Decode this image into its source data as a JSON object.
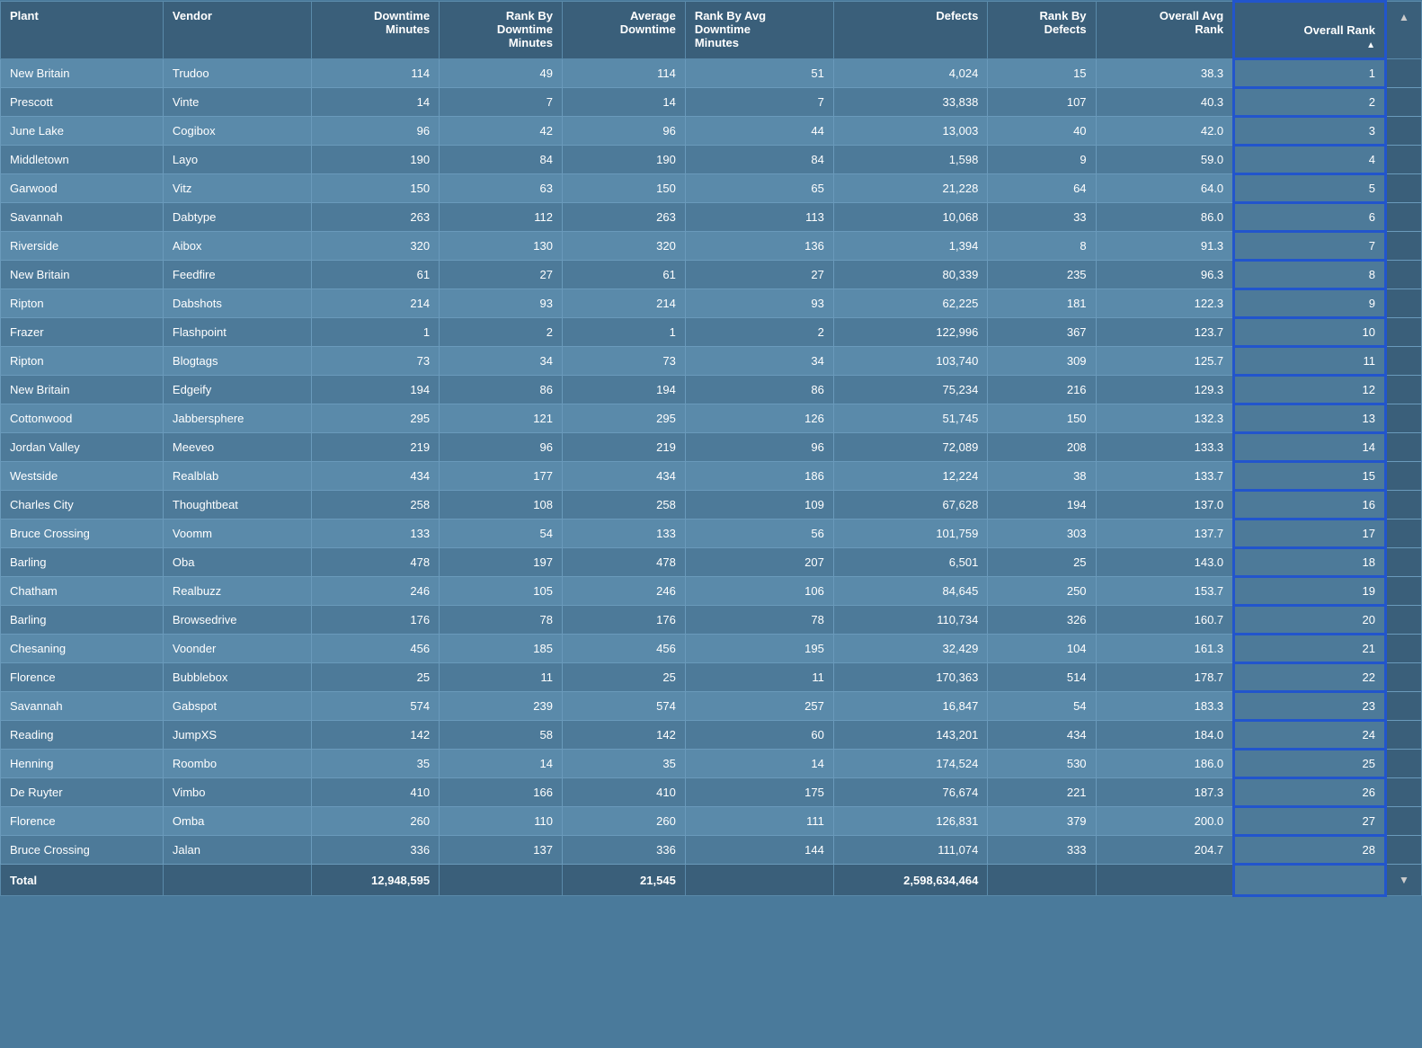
{
  "headers": {
    "plant": "Plant",
    "vendor": "Vendor",
    "downtime_minutes": "Downtime\nMinutes",
    "rank_by_downtime": "Rank By\nDowntime\nMinutes",
    "avg_downtime": "Average\nDowntime",
    "rank_by_avg": "Rank By Avg\nDowntime\nMinutes",
    "defects": "Defects",
    "rank_by_defects": "Rank By\nDefects",
    "overall_avg_rank": "Overall Avg\nRank",
    "overall_rank": "Overall Rank"
  },
  "rows": [
    {
      "plant": "New Britain",
      "vendor": "Trudoo",
      "downtime": 114,
      "rank_down": 49,
      "avg_down": 114,
      "rank_avg": 51,
      "defects": "4,024",
      "rank_def": 15,
      "overall_avg": "38.3",
      "overall_rank": 1
    },
    {
      "plant": "Prescott",
      "vendor": "Vinte",
      "downtime": 14,
      "rank_down": 7,
      "avg_down": 14,
      "rank_avg": 7,
      "defects": "33,838",
      "rank_def": 107,
      "overall_avg": "40.3",
      "overall_rank": 2
    },
    {
      "plant": "June Lake",
      "vendor": "Cogibox",
      "downtime": 96,
      "rank_down": 42,
      "avg_down": 96,
      "rank_avg": 44,
      "defects": "13,003",
      "rank_def": 40,
      "overall_avg": "42.0",
      "overall_rank": 3
    },
    {
      "plant": "Middletown",
      "vendor": "Layo",
      "downtime": 190,
      "rank_down": 84,
      "avg_down": 190,
      "rank_avg": 84,
      "defects": "1,598",
      "rank_def": 9,
      "overall_avg": "59.0",
      "overall_rank": 4
    },
    {
      "plant": "Garwood",
      "vendor": "Vitz",
      "downtime": 150,
      "rank_down": 63,
      "avg_down": 150,
      "rank_avg": 65,
      "defects": "21,228",
      "rank_def": 64,
      "overall_avg": "64.0",
      "overall_rank": 5
    },
    {
      "plant": "Savannah",
      "vendor": "Dabtype",
      "downtime": 263,
      "rank_down": 112,
      "avg_down": 263,
      "rank_avg": 113,
      "defects": "10,068",
      "rank_def": 33,
      "overall_avg": "86.0",
      "overall_rank": 6
    },
    {
      "plant": "Riverside",
      "vendor": "Aibox",
      "downtime": 320,
      "rank_down": 130,
      "avg_down": 320,
      "rank_avg": 136,
      "defects": "1,394",
      "rank_def": 8,
      "overall_avg": "91.3",
      "overall_rank": 7
    },
    {
      "plant": "New Britain",
      "vendor": "Feedfire",
      "downtime": 61,
      "rank_down": 27,
      "avg_down": 61,
      "rank_avg": 27,
      "defects": "80,339",
      "rank_def": 235,
      "overall_avg": "96.3",
      "overall_rank": 8
    },
    {
      "plant": "Ripton",
      "vendor": "Dabshots",
      "downtime": 214,
      "rank_down": 93,
      "avg_down": 214,
      "rank_avg": 93,
      "defects": "62,225",
      "rank_def": 181,
      "overall_avg": "122.3",
      "overall_rank": 9
    },
    {
      "plant": "Frazer",
      "vendor": "Flashpoint",
      "downtime": 1,
      "rank_down": 2,
      "avg_down": 1,
      "rank_avg": 2,
      "defects": "122,996",
      "rank_def": 367,
      "overall_avg": "123.7",
      "overall_rank": 10
    },
    {
      "plant": "Ripton",
      "vendor": "Blogtags",
      "downtime": 73,
      "rank_down": 34,
      "avg_down": 73,
      "rank_avg": 34,
      "defects": "103,740",
      "rank_def": 309,
      "overall_avg": "125.7",
      "overall_rank": 11
    },
    {
      "plant": "New Britain",
      "vendor": "Edgeify",
      "downtime": 194,
      "rank_down": 86,
      "avg_down": 194,
      "rank_avg": 86,
      "defects": "75,234",
      "rank_def": 216,
      "overall_avg": "129.3",
      "overall_rank": 12
    },
    {
      "plant": "Cottonwood",
      "vendor": "Jabbersphere",
      "downtime": 295,
      "rank_down": 121,
      "avg_down": 295,
      "rank_avg": 126,
      "defects": "51,745",
      "rank_def": 150,
      "overall_avg": "132.3",
      "overall_rank": 13
    },
    {
      "plant": "Jordan Valley",
      "vendor": "Meeveo",
      "downtime": 219,
      "rank_down": 96,
      "avg_down": 219,
      "rank_avg": 96,
      "defects": "72,089",
      "rank_def": 208,
      "overall_avg": "133.3",
      "overall_rank": 14
    },
    {
      "plant": "Westside",
      "vendor": "Realblab",
      "downtime": 434,
      "rank_down": 177,
      "avg_down": 434,
      "rank_avg": 186,
      "defects": "12,224",
      "rank_def": 38,
      "overall_avg": "133.7",
      "overall_rank": 15
    },
    {
      "plant": "Charles City",
      "vendor": "Thoughtbeat",
      "downtime": 258,
      "rank_down": 108,
      "avg_down": 258,
      "rank_avg": 109,
      "defects": "67,628",
      "rank_def": 194,
      "overall_avg": "137.0",
      "overall_rank": 16
    },
    {
      "plant": "Bruce Crossing",
      "vendor": "Voomm",
      "downtime": 133,
      "rank_down": 54,
      "avg_down": 133,
      "rank_avg": 56,
      "defects": "101,759",
      "rank_def": 303,
      "overall_avg": "137.7",
      "overall_rank": 17
    },
    {
      "plant": "Barling",
      "vendor": "Oba",
      "downtime": 478,
      "rank_down": 197,
      "avg_down": 478,
      "rank_avg": 207,
      "defects": "6,501",
      "rank_def": 25,
      "overall_avg": "143.0",
      "overall_rank": 18
    },
    {
      "plant": "Chatham",
      "vendor": "Realbuzz",
      "downtime": 246,
      "rank_down": 105,
      "avg_down": 246,
      "rank_avg": 106,
      "defects": "84,645",
      "rank_def": 250,
      "overall_avg": "153.7",
      "overall_rank": 19
    },
    {
      "plant": "Barling",
      "vendor": "Browsedrive",
      "downtime": 176,
      "rank_down": 78,
      "avg_down": 176,
      "rank_avg": 78,
      "defects": "110,734",
      "rank_def": 326,
      "overall_avg": "160.7",
      "overall_rank": 20
    },
    {
      "plant": "Chesaning",
      "vendor": "Voonder",
      "downtime": 456,
      "rank_down": 185,
      "avg_down": 456,
      "rank_avg": 195,
      "defects": "32,429",
      "rank_def": 104,
      "overall_avg": "161.3",
      "overall_rank": 21
    },
    {
      "plant": "Florence",
      "vendor": "Bubblebox",
      "downtime": 25,
      "rank_down": 11,
      "avg_down": 25,
      "rank_avg": 11,
      "defects": "170,363",
      "rank_def": 514,
      "overall_avg": "178.7",
      "overall_rank": 22
    },
    {
      "plant": "Savannah",
      "vendor": "Gabspot",
      "downtime": 574,
      "rank_down": 239,
      "avg_down": 574,
      "rank_avg": 257,
      "defects": "16,847",
      "rank_def": 54,
      "overall_avg": "183.3",
      "overall_rank": 23
    },
    {
      "plant": "Reading",
      "vendor": "JumpXS",
      "downtime": 142,
      "rank_down": 58,
      "avg_down": 142,
      "rank_avg": 60,
      "defects": "143,201",
      "rank_def": 434,
      "overall_avg": "184.0",
      "overall_rank": 24
    },
    {
      "plant": "Henning",
      "vendor": "Roombo",
      "downtime": 35,
      "rank_down": 14,
      "avg_down": 35,
      "rank_avg": 14,
      "defects": "174,524",
      "rank_def": 530,
      "overall_avg": "186.0",
      "overall_rank": 25
    },
    {
      "plant": "De Ruyter",
      "vendor": "Vimbo",
      "downtime": 410,
      "rank_down": 166,
      "avg_down": 410,
      "rank_avg": 175,
      "defects": "76,674",
      "rank_def": 221,
      "overall_avg": "187.3",
      "overall_rank": 26
    },
    {
      "plant": "Florence",
      "vendor": "Omba",
      "downtime": 260,
      "rank_down": 110,
      "avg_down": 260,
      "rank_avg": 111,
      "defects": "126,831",
      "rank_def": 379,
      "overall_avg": "200.0",
      "overall_rank": 27
    },
    {
      "plant": "Bruce Crossing",
      "vendor": "Jalan",
      "downtime": 336,
      "rank_down": 137,
      "avg_down": 336,
      "rank_avg": 144,
      "defects": "111,074",
      "rank_def": 333,
      "overall_avg": "204.7",
      "overall_rank": 28
    }
  ],
  "footer": {
    "label": "Total",
    "downtime": "12,948,595",
    "avg_down": "21,545",
    "defects": "2,598,634,464"
  }
}
